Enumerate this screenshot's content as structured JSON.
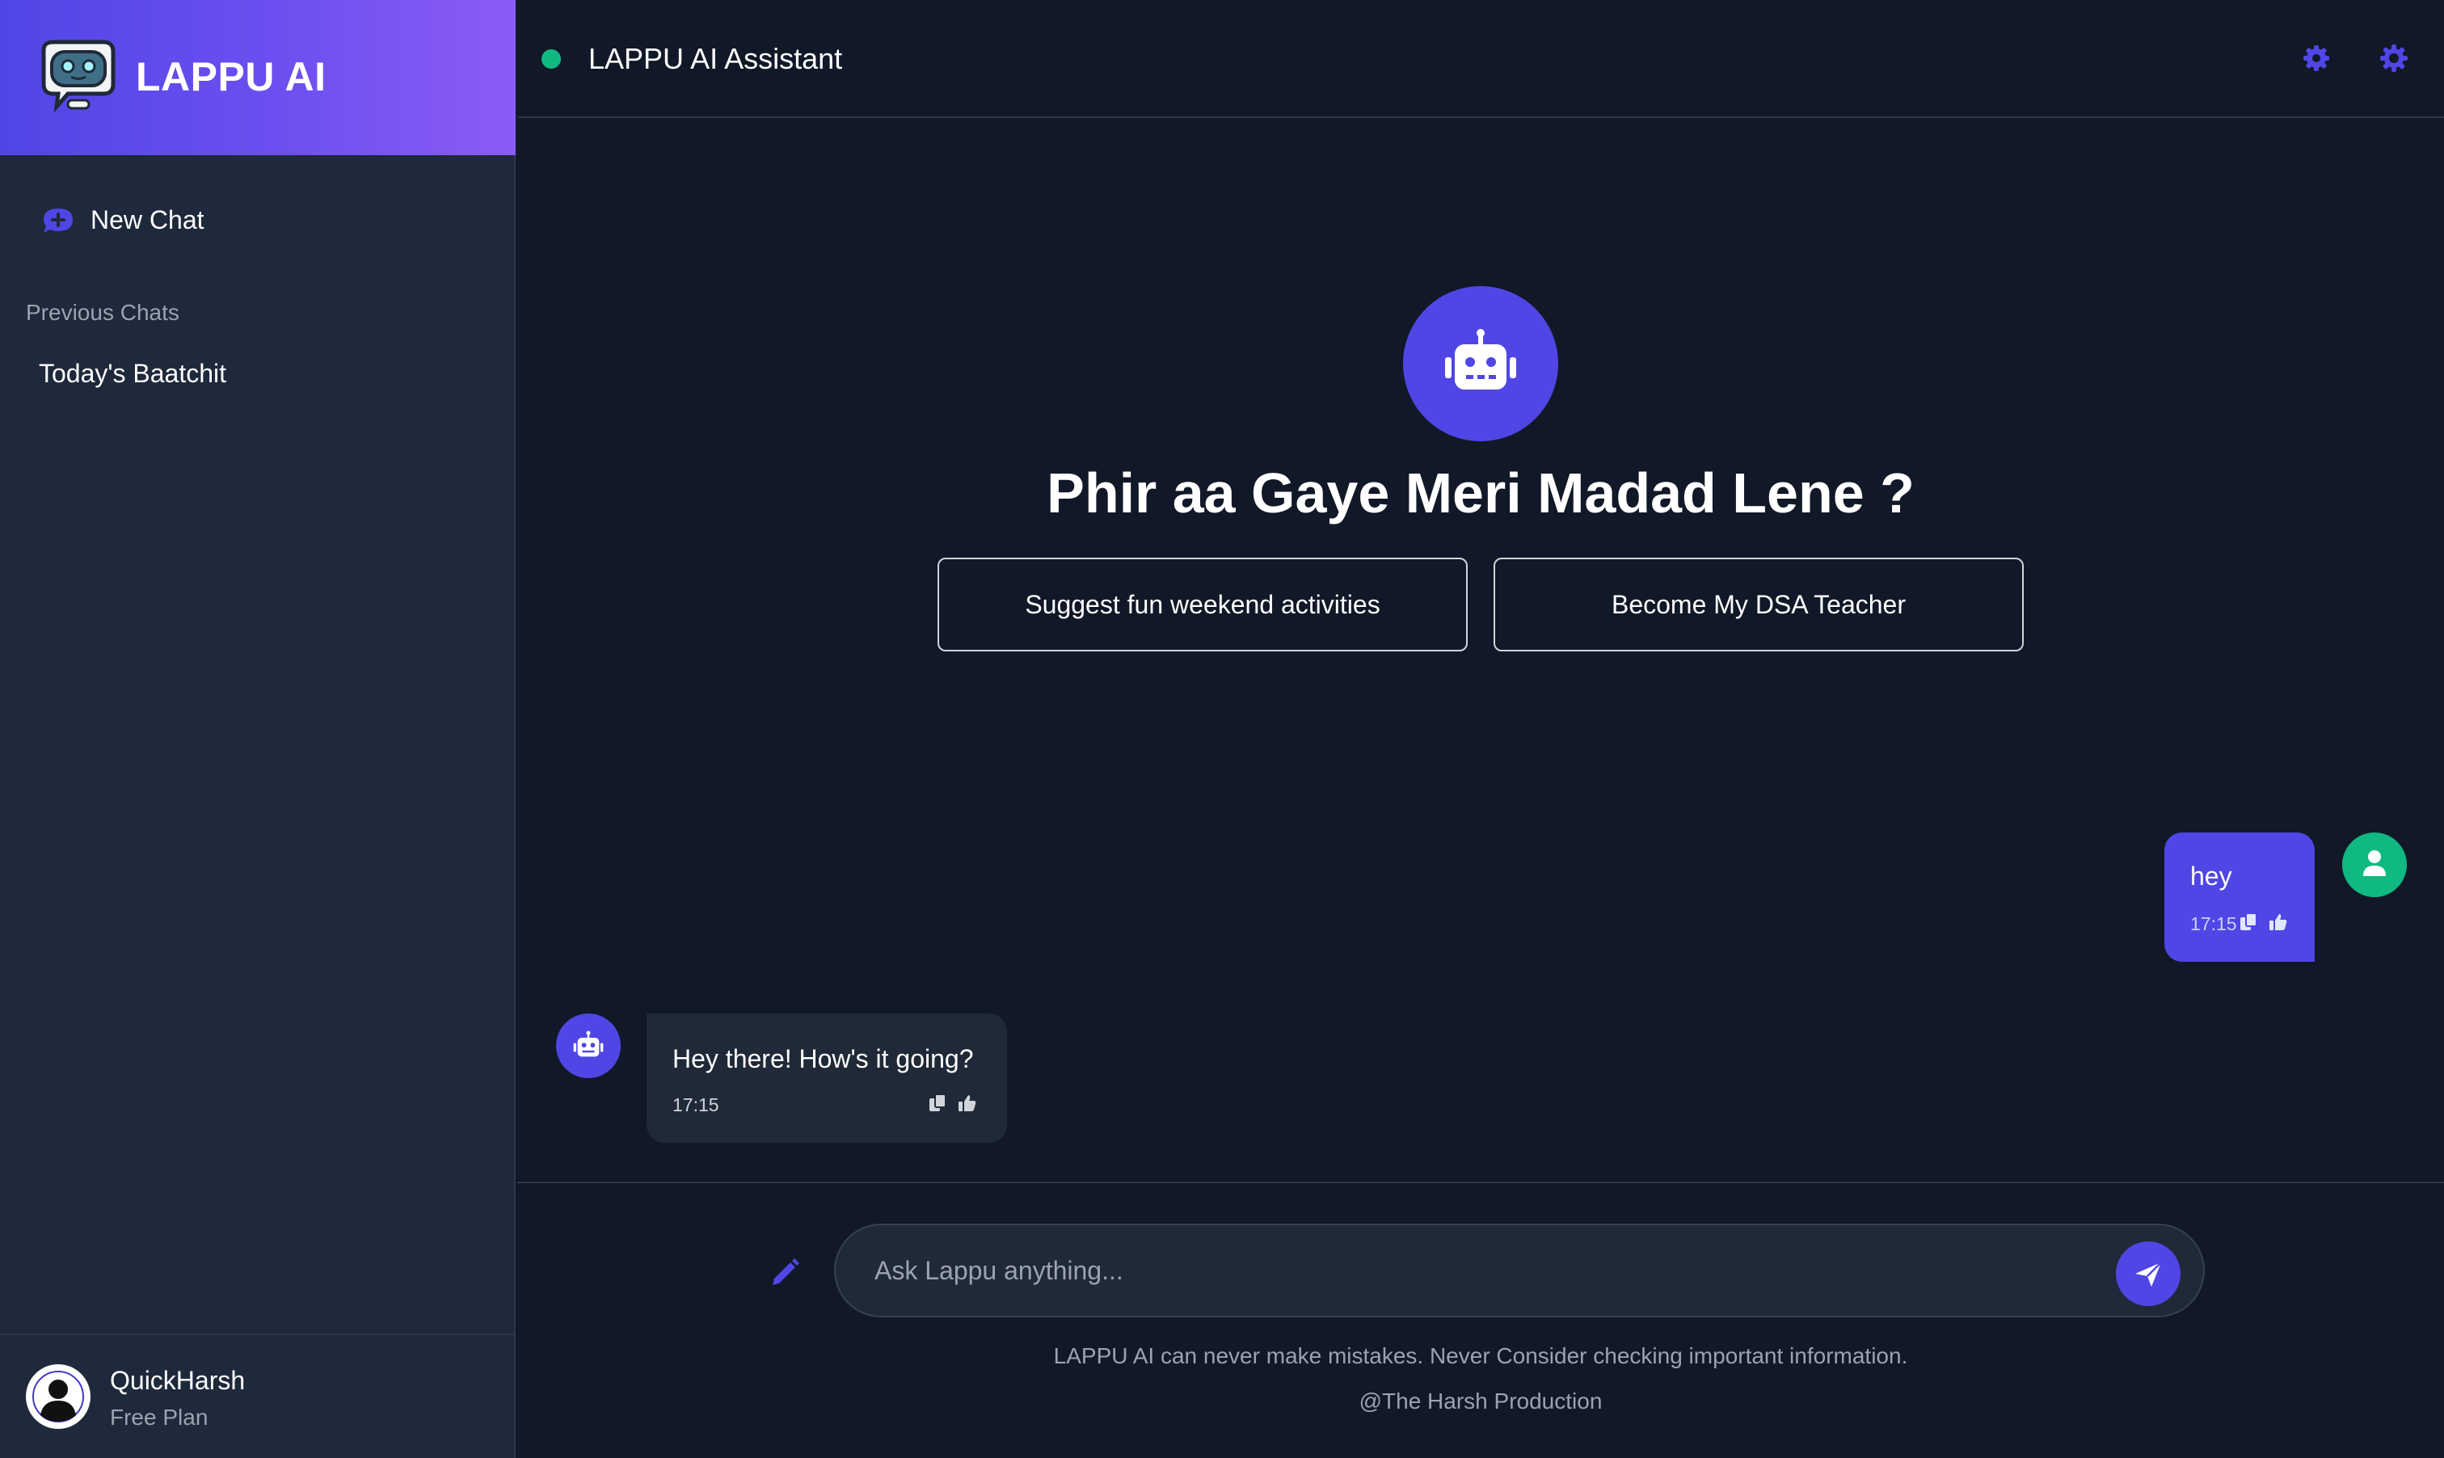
{
  "sidebar": {
    "brand_title": "LAPPU AI",
    "new_chat_label": "New Chat",
    "previous_heading": "Previous Chats",
    "history": [
      "Today's Baatchit"
    ],
    "user": {
      "name": "QuickHarsh",
      "plan": "Free Plan"
    }
  },
  "header": {
    "title": "LAPPU AI Assistant",
    "status": "online",
    "icons": [
      "settings-icon",
      "theme-gear-icon"
    ]
  },
  "welcome": {
    "heading": "Phir aa Gaye Meri Madad Lene ?",
    "suggestions": [
      "Suggest fun weekend activities",
      "Become My DSA Teacher"
    ]
  },
  "messages": [
    {
      "role": "user",
      "text": "hey",
      "time": "17:15"
    },
    {
      "role": "bot",
      "text": "Hey there! How's it going?",
      "time": "17:15"
    }
  ],
  "composer": {
    "placeholder": "Ask Lappu anything...",
    "disclaimer": "LAPPU AI can never make mistakes. Never Consider checking important information.",
    "credit": "@The Harsh Production"
  },
  "colors": {
    "accent": "#4f46e5",
    "online": "#10b981",
    "background": "#111827",
    "sidebar": "#1e293b"
  }
}
